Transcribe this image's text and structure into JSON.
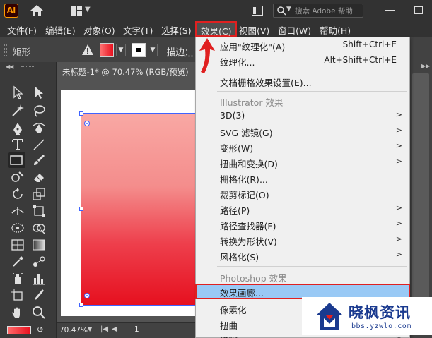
{
  "app": {
    "logo_text": "Ai",
    "search_placeholder": "搜索 Adobe 帮助",
    "accent": "#ff9a00",
    "highlight_border": "#e02020"
  },
  "menubar": {
    "items": [
      {
        "label": "文件(F)"
      },
      {
        "label": "编辑(E)"
      },
      {
        "label": "对象(O)"
      },
      {
        "label": "文字(T)"
      },
      {
        "label": "选择(S)"
      },
      {
        "label": "效果(C)"
      },
      {
        "label": "视图(V)"
      },
      {
        "label": "窗口(W)"
      },
      {
        "label": "帮助(H)"
      }
    ],
    "active_index": 5
  },
  "control_bar": {
    "selection_type": "矩形",
    "stroke_label": "描边：",
    "fill_color": "#e8101e",
    "stroke_color": "#ffffff"
  },
  "document": {
    "tab_label": "未标题-1* @ 70.47% (RGB/预览)",
    "zoom": "70.47%",
    "page": "1",
    "rect_gradient_top": "#f9a8a4",
    "rect_gradient_bottom": "#e6101f"
  },
  "effect_menu": {
    "items": [
      {
        "label": "应用\"纹理化\"(A)",
        "shortcut": "Shift+Ctrl+E"
      },
      {
        "label": "纹理化...",
        "shortcut": "Alt+Shift+Ctrl+E"
      },
      {
        "label": "文档栅格效果设置(E)..."
      },
      {
        "header": "Illustrator 效果"
      },
      {
        "label": "3D(3)",
        "submenu": ">"
      },
      {
        "label": "SVG 滤镜(G)",
        "submenu": ">"
      },
      {
        "label": "变形(W)",
        "submenu": ">"
      },
      {
        "label": "扭曲和变换(D)",
        "submenu": ">"
      },
      {
        "label": "栅格化(R)..."
      },
      {
        "label": "裁剪标记(O)"
      },
      {
        "label": "路径(P)",
        "submenu": ">"
      },
      {
        "label": "路径查找器(F)",
        "submenu": ">"
      },
      {
        "label": "转换为形状(V)",
        "submenu": ">"
      },
      {
        "label": "风格化(S)",
        "submenu": ">"
      },
      {
        "header": "Photoshop 效果"
      },
      {
        "label": "效果画廊..."
      },
      {
        "label": "像素化",
        "submenu": ">"
      },
      {
        "label": "扭曲",
        "submenu": ">"
      },
      {
        "label": "模糊",
        "submenu": ">"
      }
    ],
    "highlight_color": "#99c9f5"
  },
  "watermark": {
    "title": "晓枫资讯",
    "url": "bbs.yzwlo.com"
  }
}
